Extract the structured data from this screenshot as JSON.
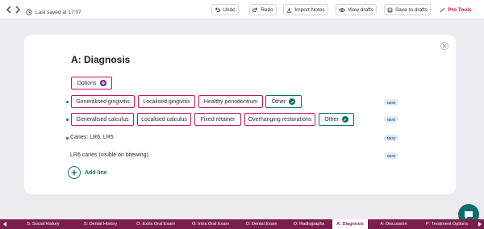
{
  "topbar": {
    "saved_text": "Last saved at 17:07",
    "undo_label": "Undo",
    "redo_label": "Redo",
    "import_label": "Import Notes",
    "view_drafts_label": "View drafts",
    "save_drafts_label": "Save to drafts",
    "pro_tools_label": "Pro Tools"
  },
  "card": {
    "title": "A: Diagnosis",
    "options_label": "Options",
    "row1": {
      "chips": [
        "Generalised gingivitis",
        "Localised gingivitis",
        "Healthy periodontium"
      ],
      "other_label": "Other",
      "badge": "NEW"
    },
    "row2": {
      "chips": [
        "Generalised calculus",
        "Localised calculus",
        "Fixed retainer",
        "Overhanging restorations"
      ],
      "other_label": "Other",
      "badge": "NEW"
    },
    "row3": {
      "text": "Caries:  LR6, LR5",
      "badge": "NEW"
    },
    "row4": {
      "text": "LR6 caries (visible on bitewing)",
      "badge": "NEW"
    },
    "add_line_label": "Add line"
  },
  "tabs": [
    {
      "label": "S: Social History",
      "active": false
    },
    {
      "label": "S: Dental History",
      "active": false
    },
    {
      "label": "O: Extra Oral Exam",
      "active": false
    },
    {
      "label": "O: Intra Oral Exam",
      "active": false
    },
    {
      "label": "O: Dental Exam",
      "active": false
    },
    {
      "label": "O: Radiographs",
      "active": false
    },
    {
      "label": "A: Diagnosis",
      "active": true
    },
    {
      "label": "A: Discussion",
      "active": false
    },
    {
      "label": "P: Treatment Options",
      "active": false
    }
  ],
  "colors": {
    "accent_pink": "#c0185a",
    "accent_teal": "#0d6e6e",
    "tabbar": "#7a1f4d",
    "pro_red": "#c8102e"
  },
  "icons": {
    "back": "arrow-left-icon",
    "forward": "arrow-right-icon",
    "clock": "clock-icon",
    "undo": "undo-icon",
    "redo": "redo-icon",
    "import": "import-icon",
    "view": "eye-icon",
    "save": "save-icon",
    "pro": "wand-icon",
    "close": "close-icon",
    "options": "gear-icon",
    "edit": "pencil-icon",
    "add": "plus-icon",
    "chat": "chat-icon"
  }
}
